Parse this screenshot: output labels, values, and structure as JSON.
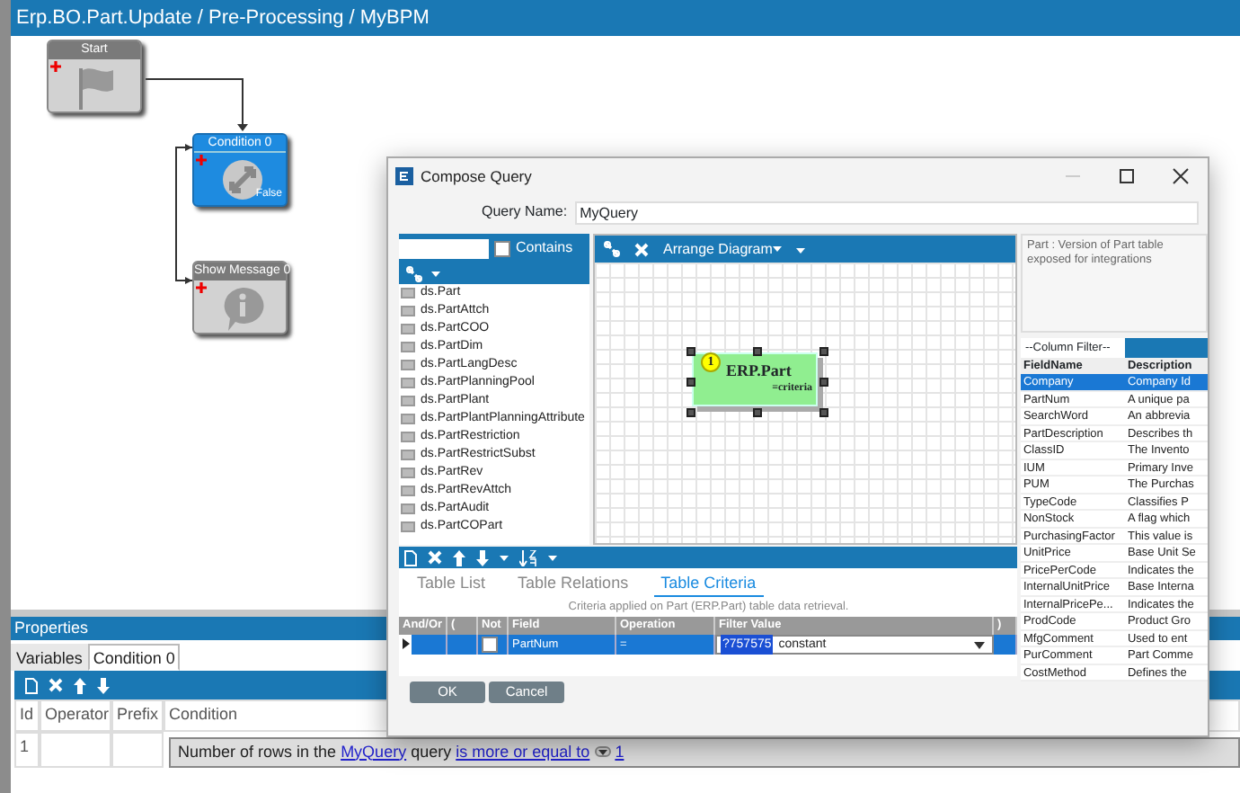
{
  "window": {
    "title": "Erp.BO.Part.Update / Pre-Processing / MyBPM"
  },
  "diagram": {
    "nodes": [
      {
        "kind": "start",
        "title": "Start",
        "selected": false
      },
      {
        "kind": "condition",
        "title": "Condition 0",
        "selected": true,
        "port_label": "False"
      },
      {
        "kind": "message",
        "title": "Show Message 0",
        "selected": false
      }
    ]
  },
  "properties": {
    "title": "Properties",
    "tabs": [
      {
        "label": "Variables",
        "selected": false
      },
      {
        "label": "Condition 0",
        "selected": true
      }
    ],
    "columns": [
      "Id",
      "Operator",
      "Prefix",
      "Condition"
    ],
    "rows": [
      {
        "id": "1",
        "condition": [
          {
            "kind": "text",
            "text": "Number of rows in the"
          },
          {
            "kind": "link",
            "text": "MyQuery"
          },
          {
            "kind": "text",
            "text": "query"
          },
          {
            "kind": "link",
            "text": "is more or equal to"
          },
          {
            "kind": "dropdown"
          },
          {
            "kind": "link",
            "text": "1"
          }
        ]
      }
    ]
  },
  "dialog": {
    "title": "Compose Query",
    "query_name_label": "Query Name:",
    "query_name": "MyQuery",
    "contains": {
      "label": "Contains",
      "checked": false
    },
    "tables": [
      "ds.Part",
      "ds.PartAttch",
      "ds.PartCOO",
      "ds.PartDim",
      "ds.PartLangDesc",
      "ds.PartPlanningPool",
      "ds.PartPlant",
      "ds.PartPlantPlanningAttribute",
      "ds.PartRestriction",
      "ds.PartRestrictSubst",
      "ds.PartRev",
      "ds.PartRevAttch",
      "ds.PartAudit",
      "ds.PartCOPart"
    ],
    "arrange_label": "Arrange Diagram",
    "entity": {
      "number": "1",
      "name": "ERP.Part",
      "criteria_label": "=criteria"
    },
    "description": "Part : Version of Part table exposed for integrations",
    "column_filter": "--Column Filter--",
    "fields": {
      "columns": [
        "FieldName",
        "Description"
      ],
      "rows": [
        {
          "name": "Company",
          "description": "Company Id",
          "selected": true
        },
        {
          "name": "PartNum",
          "description": "A unique pa",
          "selected": false
        },
        {
          "name": "SearchWord",
          "description": "An abbrevia",
          "selected": false
        },
        {
          "name": "PartDescription",
          "description": "Describes th",
          "selected": false
        },
        {
          "name": "ClassID",
          "description": "The Invento",
          "selected": false
        },
        {
          "name": "IUM",
          "description": "Primary Inve",
          "selected": false
        },
        {
          "name": "PUM",
          "description": "The Purchas",
          "selected": false
        },
        {
          "name": "TypeCode",
          "description": "Classifies P",
          "selected": false
        },
        {
          "name": "NonStock",
          "description": "A flag which",
          "selected": false
        },
        {
          "name": "PurchasingFactor",
          "description": "This value is",
          "selected": false
        },
        {
          "name": "UnitPrice",
          "description": "Base Unit Se",
          "selected": false
        },
        {
          "name": "PricePerCode",
          "description": "Indicates the",
          "selected": false
        },
        {
          "name": "InternalUnitPrice",
          "description": "Base Interna",
          "selected": false
        },
        {
          "name": "InternalPricePe...",
          "description": "Indicates the",
          "selected": false
        },
        {
          "name": "ProdCode",
          "description": "Product Gro",
          "selected": false
        },
        {
          "name": "MfgComment",
          "description": "Used to ent",
          "selected": false
        },
        {
          "name": "PurComment",
          "description": "Part Comme",
          "selected": false
        },
        {
          "name": "CostMethod",
          "description": "Defines the",
          "selected": false
        }
      ]
    },
    "tabs": [
      {
        "label": "Table List",
        "selected": false
      },
      {
        "label": "Table Relations",
        "selected": false
      },
      {
        "label": "Table Criteria",
        "selected": true
      }
    ],
    "criteria_caption": "Criteria applied on Part (ERP.Part)  table data retrieval.",
    "criteria": {
      "columns": [
        "And/Or",
        "(",
        "Not",
        "Field",
        "Operation",
        "Filter Value",
        ")"
      ],
      "rows": [
        {
          "selected": true,
          "not": false,
          "field": "PartNum",
          "operation": "=",
          "filter_value": "?757575",
          "filter_note": "constant"
        }
      ]
    },
    "buttons": [
      "OK",
      "Cancel"
    ]
  }
}
